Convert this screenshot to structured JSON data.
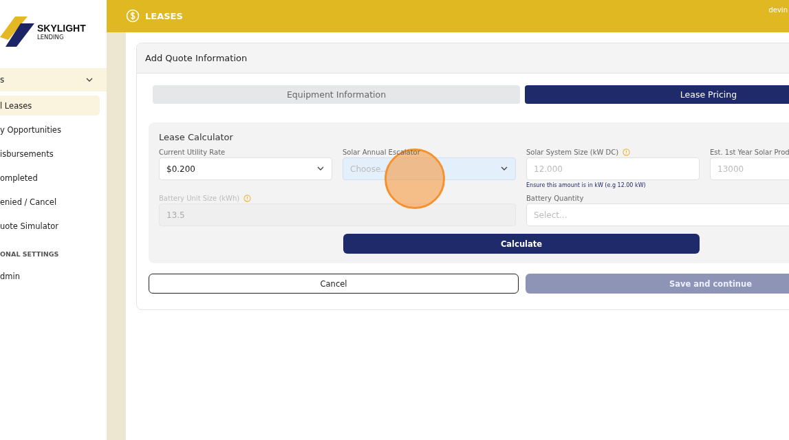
{
  "brand": {
    "name": "SKYLIGHT",
    "tagline": "LENDING"
  },
  "sidebar": {
    "section": {
      "label": "s",
      "expanded": true
    },
    "items": [
      {
        "label": "l Leases",
        "selected": true
      },
      {
        "label": "y Opportunities",
        "selected": false
      },
      {
        "label": "isbursements",
        "selected": false
      },
      {
        "label": "ompleted",
        "selected": false
      },
      {
        "label": "enied / Cancel",
        "selected": false
      },
      {
        "label": "uote Simulator",
        "selected": false
      }
    ],
    "group_heading": "ONAL SETTINGS",
    "extra_items": [
      {
        "label": "dmin",
        "selected": false
      }
    ]
  },
  "header": {
    "title": "LEASES",
    "user": "devin"
  },
  "card": {
    "title": "Add Quote Information",
    "tabs": [
      {
        "label": "Equipment Information",
        "selected": false
      },
      {
        "label": "Lease Pricing",
        "selected": true
      }
    ],
    "calculator": {
      "title": "Lease Calculator",
      "fields": [
        {
          "kind": "select",
          "label": "Current Utility Rate",
          "value": "$0.200",
          "info": false,
          "disabled": false,
          "focused": false,
          "span": false
        },
        {
          "kind": "select",
          "label": "Solar Annual Escalator",
          "placeholder": "Choose...",
          "info": false,
          "disabled": false,
          "focused": true,
          "span": false
        },
        {
          "kind": "input",
          "label": "Solar System Size (kW DC)",
          "placeholder": "12.000",
          "info": true,
          "disabled": false,
          "focused": false,
          "span": false,
          "hint": "Ensure this amount is in kW (e.g 12.00 kW)"
        },
        {
          "kind": "input",
          "label": "Est. 1st Year Solar Prod",
          "placeholder": "13000",
          "info": false,
          "disabled": false,
          "focused": false,
          "span": false
        },
        {
          "kind": "input",
          "label": "Battery Unit Size (kWh)",
          "value": "13.5",
          "info": true,
          "disabled": true,
          "focused": false,
          "span": true
        },
        {
          "kind": "input",
          "label": "Battery Quantity",
          "placeholder": "Select...",
          "info": false,
          "disabled": false,
          "focused": false,
          "span": true
        }
      ],
      "calculate": "Calculate"
    },
    "actions": [
      {
        "label": "Cancel",
        "kind": "outline",
        "disabled": false
      },
      {
        "label": "Save and continue",
        "kind": "primary",
        "disabled": true
      }
    ]
  },
  "click_marker": true
}
